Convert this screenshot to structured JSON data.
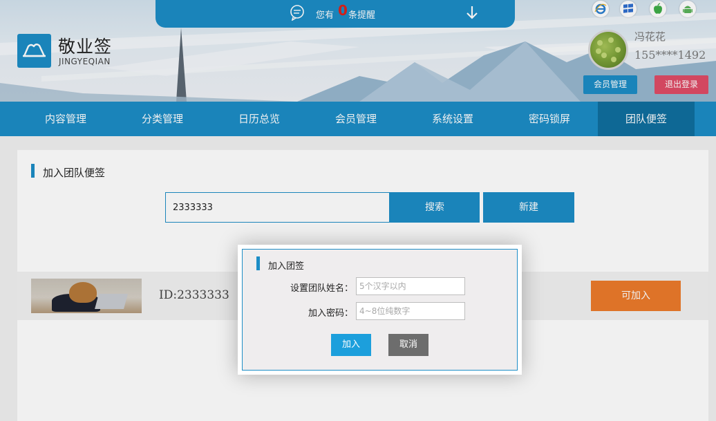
{
  "brand": {
    "title": "敬业签",
    "subtitle": "JINGYEQIAN"
  },
  "notice": {
    "prefix": "您有",
    "count": "0",
    "suffix": "条提醒"
  },
  "platforms": [
    "ie-icon",
    "windows-icon",
    "apple-icon",
    "android-icon"
  ],
  "user": {
    "name": "冯花花",
    "phone": "155****1492",
    "member_btn": "会员管理",
    "logout_btn": "退出登录"
  },
  "nav": {
    "items": [
      "内容管理",
      "分类管理",
      "日历总览",
      "会员管理",
      "系统设置",
      "密码锁屏",
      "团队便签"
    ],
    "active": "团队便签"
  },
  "panel": {
    "title": "加入团队便签",
    "search_value": "2333333",
    "search_btn": "搜索",
    "new_btn": "新建"
  },
  "result": {
    "id_text": "ID:2333333",
    "join_btn": "可加入"
  },
  "dialog": {
    "title": "加入团签",
    "name_label": "设置团队姓名：",
    "name_placeholder": "5个汉字以内",
    "pwd_label": "加入密码：",
    "pwd_placeholder": "4~8位纯数字",
    "ok": "加入",
    "cancel": "取消"
  },
  "colors": {
    "primary": "#1c8dc6",
    "danger": "#e04c66",
    "orange": "#ec7b2b",
    "nav_active": "#0f6f9f"
  }
}
